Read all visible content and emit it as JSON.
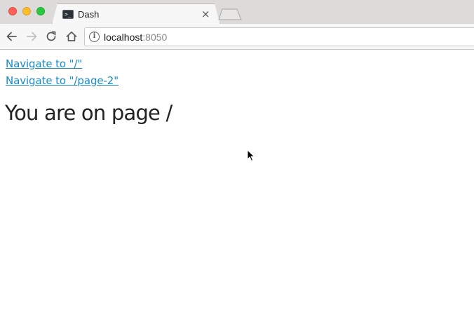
{
  "browser": {
    "tab": {
      "title": "Dash",
      "close_glyph": "×"
    },
    "address_bar": {
      "host": "localhost",
      "port": ":8050",
      "info_glyph": "i"
    },
    "icons": [
      "back-arrow-icon",
      "forward-arrow-icon",
      "reload-icon",
      "home-icon",
      "info-icon",
      "terminal-favicon-icon",
      "close-icon"
    ],
    "colors": {
      "titlebar": "#dddbd9",
      "tab": "#f7f7f7",
      "close": "#fc5f57",
      "minimize": "#fdbc2e",
      "zoom": "#28c840"
    }
  },
  "page": {
    "links": [
      {
        "label": "Navigate to \"/\""
      },
      {
        "label": "Navigate to \"/page-2\""
      }
    ],
    "heading": "You are on page /",
    "colors": {
      "link": "#1a8bc7",
      "heading": "#222222"
    }
  }
}
